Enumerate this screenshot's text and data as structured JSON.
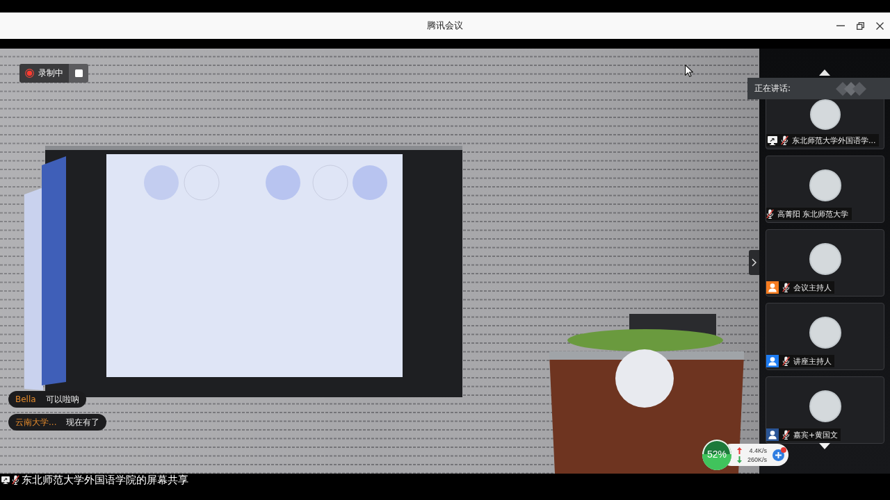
{
  "window": {
    "title": "腾讯会议"
  },
  "recording": {
    "label": "录制中"
  },
  "chat_messages": [
    {
      "sender": "Bella",
      "text": "可以啦呐"
    },
    {
      "sender": "云南大学...",
      "text": "现在有了"
    }
  ],
  "speaking_banner": {
    "label": "正在讲话:"
  },
  "participants": [
    {
      "name": "东北师范大学外国语学...",
      "kind": "sharing",
      "muted": true
    },
    {
      "name": "高菁阳 东北师范大学",
      "kind": "member",
      "muted": true
    },
    {
      "name": "会议主持人",
      "kind": "host",
      "muted": true
    },
    {
      "name": "讲座主持人",
      "kind": "cohost",
      "muted": true
    },
    {
      "name": "嘉宾+黄国文",
      "kind": "guest",
      "muted": true
    }
  ],
  "network": {
    "usage": "52%",
    "level": 0.52,
    "upload": "4.4K/s",
    "download": "260K/s"
  },
  "share_status": {
    "label": "东北师范大学外国语学院的屏幕共享",
    "muted": true
  }
}
